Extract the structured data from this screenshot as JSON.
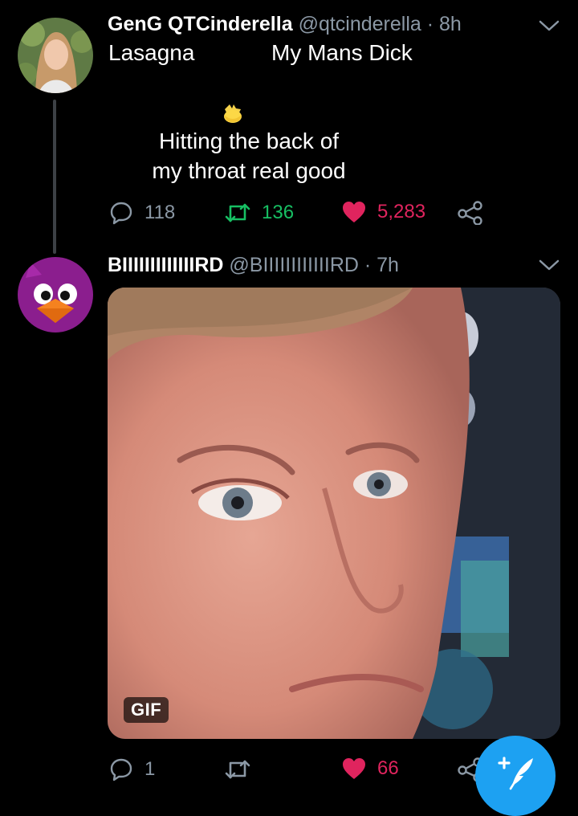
{
  "tweet1": {
    "display_name": "GenG QTCinderella",
    "handle_time": "@qtcinderella · 8h",
    "label_left": "Lasagna",
    "label_right": "My Mans Dick",
    "body_line1": "Hitting the back of",
    "body_line2": "my throat real good",
    "replies": "118",
    "retweets": "136",
    "likes": "5,283"
  },
  "tweet2": {
    "display_name": "BIIIIIIIIIIIIIRD",
    "handle_time": "@BIIIIIIIIIIIIRD · 7h",
    "media_badge": "GIF",
    "replies": "1",
    "likes": "66"
  },
  "colors": {
    "background": "#000000",
    "retweet_active": "#17bf63",
    "like_active": "#e0245e",
    "muted": "#8b98a5",
    "fab": "#1da1f2"
  },
  "icons": [
    "reply-icon",
    "retweet-icon",
    "heart-icon",
    "share-icon",
    "chevron-down-icon",
    "compose-icon",
    "chick-emoji"
  ]
}
